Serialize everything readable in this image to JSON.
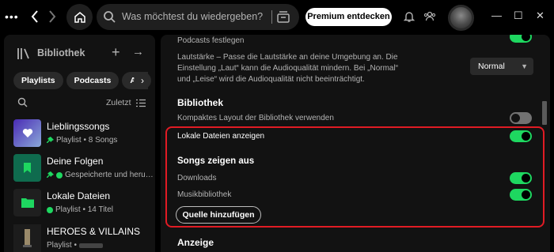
{
  "topbar": {
    "dots": "•••",
    "search_placeholder": "Was möchtest du wiedergeben?",
    "premium_label": "Premium entdecken",
    "icons": [
      "more-dots-icon",
      "back-arrow-icon",
      "forward-arrow-icon",
      "home-icon",
      "search-icon",
      "browse-icon",
      "bell-icon",
      "friends-icon",
      "minimize-icon",
      "maximize-icon",
      "close-icon"
    ],
    "window": {
      "minimize": "—",
      "maximize": "☐",
      "close": "✕"
    }
  },
  "library": {
    "title": "Bibliothek",
    "plus": "+",
    "arrow": "→",
    "chips": [
      "Playlists",
      "Podcasts",
      "Alben"
    ],
    "sort_label": "Zuletzt",
    "items": [
      {
        "name": "Lieblingssongs",
        "sub": "Playlist • 8 Songs",
        "cover_color": "#5038a0",
        "pinned": true
      },
      {
        "name": "Deine Folgen",
        "sub": "Gespeicherte und heru…",
        "cover_color": "#0f6b4e",
        "pinned": true,
        "downloaded": true
      },
      {
        "name": "Lokale Dateien",
        "sub": "Playlist • 14 Titel",
        "cover_color": "#1a1a1a",
        "downloaded": true
      },
      {
        "name": "HEROES & VILLAINS",
        "sub": "Playlist • ",
        "cover_color": "#2b2b2b"
      }
    ]
  },
  "settings": {
    "podcasts_label": "Podcasts festlegen",
    "volume_line1": "Lautstärke – Passe die Lautstärke an deine Umgebung an. Die",
    "volume_line2": "Einstellung „Laut“ kann die Audioqualität mindern. Bei „Normal“",
    "volume_line3": "und „Leise“ wird die Audioqualität nicht beeinträchtigt.",
    "volume_value": "Normal",
    "library_heading": "Bibliothek",
    "compact_label": "Kompaktes Layout der Bibliothek verwenden",
    "local_files_label": "Lokale Dateien anzeigen",
    "songs_heading": "Songs zeigen aus",
    "downloads_label": "Downloads",
    "music_library_label": "Musikbibliothek",
    "add_source_label": "Quelle hinzufügen",
    "display_heading": "Anzeige",
    "toggles": {
      "podcasts": true,
      "compact": false,
      "local_files": true,
      "downloads": true,
      "music_library": true
    },
    "accent_color": "#1ed760",
    "highlight_color": "#e01b24"
  }
}
